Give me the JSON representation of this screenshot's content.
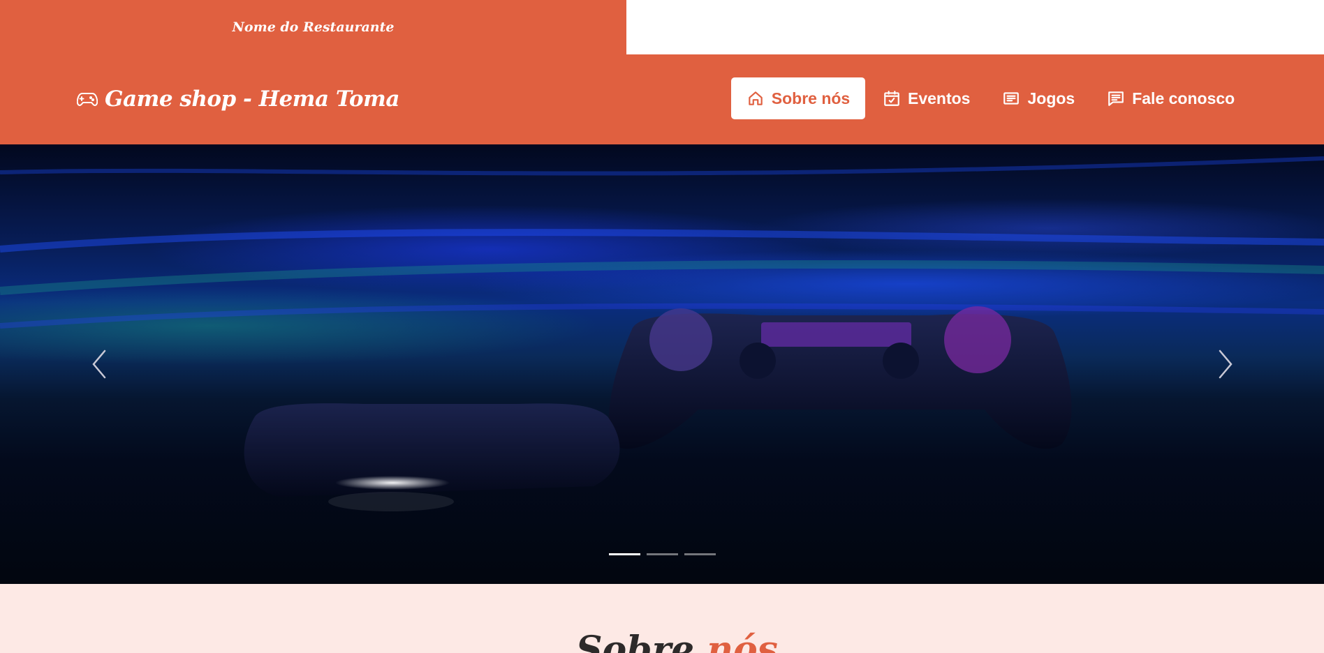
{
  "topbar": {
    "restaurant_name": "Nome do Restaurante"
  },
  "brand": {
    "icon": "gamepad-icon",
    "name": "Game shop - Hema Toma"
  },
  "nav": {
    "items": [
      {
        "label": "Sobre nós",
        "icon": "home-icon",
        "active": true
      },
      {
        "label": "Eventos",
        "icon": "calendar-check-icon",
        "active": false
      },
      {
        "label": "Jogos",
        "icon": "article-icon",
        "active": false
      },
      {
        "label": "Fale conosco",
        "icon": "chat-icon",
        "active": false
      }
    ]
  },
  "carousel": {
    "slides": 3,
    "active_slide": 1,
    "prev_icon": "chevron-left-icon",
    "next_icon": "chevron-right-icon"
  },
  "section": {
    "title_part1": "Sobre ",
    "title_accent": "nós"
  },
  "colors": {
    "primary": "#e06040",
    "background": "#fde9e5",
    "white": "#ffffff",
    "title": "#2d2a2a"
  }
}
